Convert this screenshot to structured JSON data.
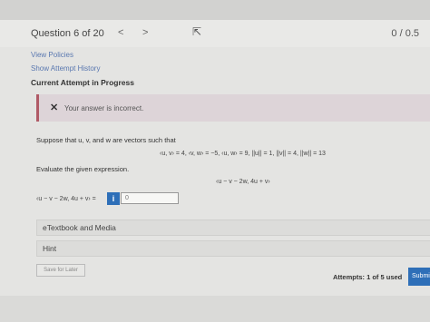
{
  "header": {
    "question": "Question 6 of 20",
    "prev_glyph": "<",
    "next_glyph": ">",
    "score": "0 / 0.5"
  },
  "links": {
    "view_policies": "View Policies",
    "show_history": "Show Attempt History"
  },
  "current_attempt": "Current Attempt in Progress",
  "alert": {
    "icon": "x-icon",
    "message": "Your answer is incorrect."
  },
  "question": {
    "prompt": "Suppose that u, v, and w are vectors such that",
    "given": "‹u, v› = 4, ‹v, w› = −5, ‹u, w› = 9, ||u|| = 1, ||v|| = 4, ||w|| = 13",
    "instruction": "Evaluate the given expression.",
    "expression": "‹u − v − 2w, 4u + v›"
  },
  "answer": {
    "label": "‹u − v − 2w, 4u + v› =",
    "info_glyph": "i",
    "value": "0"
  },
  "panels": {
    "etextbook": "eTextbook and Media",
    "hint": "Hint"
  },
  "footer": {
    "save_label": "Save for Later",
    "attempts": "Attempts: 1 of 5 used",
    "submit_label": "Submit"
  },
  "colors": {
    "accent": "#2e6fb8",
    "alert_border": "#b05a66",
    "link": "#5a78b0"
  }
}
